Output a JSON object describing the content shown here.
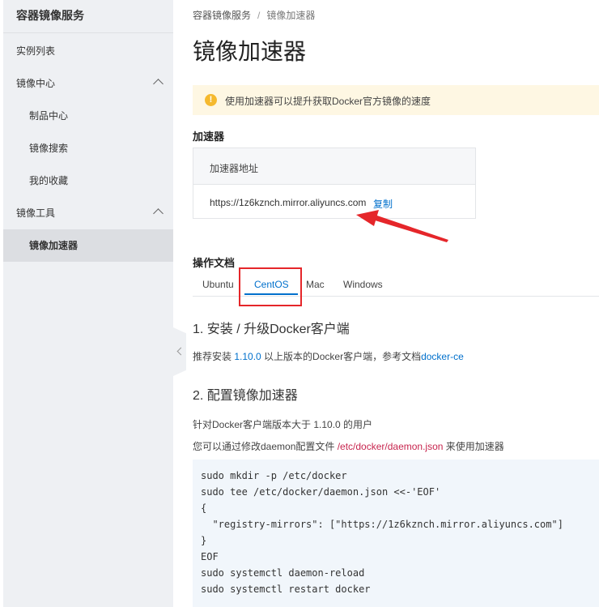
{
  "sidebar": {
    "title": "容器镜像服务",
    "items": [
      {
        "label": "实例列表"
      },
      {
        "label": "镜像中心"
      },
      {
        "label": "制品中心"
      },
      {
        "label": "镜像搜索"
      },
      {
        "label": "我的收藏"
      },
      {
        "label": "镜像工具"
      },
      {
        "label": "镜像加速器"
      }
    ]
  },
  "breadcrumb": {
    "root": "容器镜像服务",
    "separator": "/",
    "current": "镜像加速器"
  },
  "page_title": "镜像加速器",
  "notice": {
    "icon": "!",
    "text": "使用加速器可以提升获取Docker官方镜像的速度"
  },
  "accelerator": {
    "section_label": "加速器",
    "header": "加速器地址",
    "url": "https://1z6kznch.mirror.aliyuncs.com",
    "copy_label": "复制"
  },
  "docs": {
    "section_label": "操作文档",
    "tabs": [
      {
        "label": "Ubuntu"
      },
      {
        "label": "CentOS"
      },
      {
        "label": "Mac"
      },
      {
        "label": "Windows"
      }
    ],
    "step1_title": "1. 安装 / 升级Docker客户端",
    "step1_text_a": "推荐安装 ",
    "step1_version": "1.10.0",
    "step1_text_b": " 以上版本的Docker客户端，参考文档",
    "step1_link": "docker-ce",
    "step2_title": "2. 配置镜像加速器",
    "step2_line1": "针对Docker客户端版本大于 1.10.0 的用户",
    "step2_line2_a": "您可以通过修改daemon配置文件 ",
    "step2_path": "/etc/docker/daemon.json",
    "step2_line2_b": " 来使用加速器",
    "code_lines": [
      "sudo mkdir -p /etc/docker",
      "sudo tee /etc/docker/daemon.json <<-'EOF'",
      "{",
      "  \"registry-mirrors\": [\"https://1z6kznch.mirror.aliyuncs.com\"]",
      "}",
      "EOF",
      "sudo systemctl daemon-reload",
      "sudo systemctl restart docker"
    ]
  },
  "colors": {
    "accent": "#0070cc",
    "annotation_red": "#e5262a",
    "notice_bg": "#fef7e3"
  }
}
